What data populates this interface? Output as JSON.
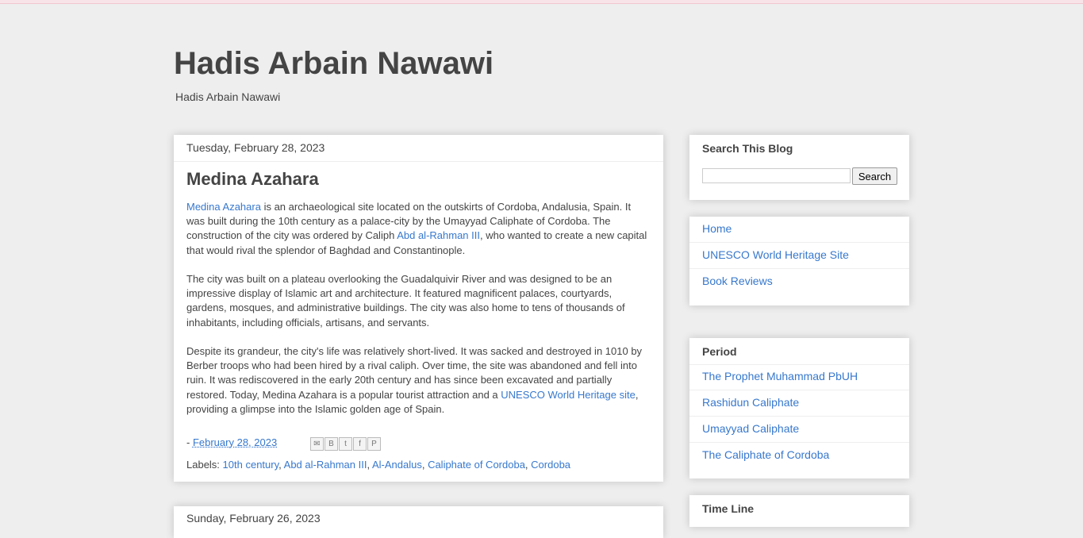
{
  "header": {
    "title": "Hadis Arbain Nawawi",
    "description": "Hadis Arbain Nawawi"
  },
  "post": {
    "date_header": "Tuesday, February 28, 2023",
    "title": "Medina Azahara",
    "p1_link1": "Medina Azahara",
    "p1_text1": " is an archaeological site located on the outskirts of Cordoba, Andalusia, Spain. It was built during the 10th century as a palace-city by the Umayyad Caliphate of Cordoba. The construction of the city was ordered by Caliph ",
    "p1_link2": "Abd al-Rahman III",
    "p1_text2": ", who wanted to create a new capital that would rival the splendor of Baghdad and Constantinople.",
    "p2_text": "The city was built on a plateau overlooking the Guadalquivir River and was designed to be an impressive display of Islamic art and architecture. It featured magnificent palaces, courtyards, gardens, mosques, and administrative buildings. The city was also home to tens of thousands of inhabitants, including officials, artisans, and servants.",
    "p3_text1": "Despite its grandeur, the city's life was relatively short-lived. It was sacked and destroyed in 1010 by Berber troops who had been hired by a rival caliph. Over time, the site was abandoned and fell into ruin. It was rediscovered in the early 20th century and has since been excavated and partially restored. Today, Medina Azahara is a popular tourist attraction and a ",
    "p3_link": "UNESCO World Heritage site",
    "p3_text2": ", providing a glimpse into the Islamic golden age of Spain.",
    "footer_prefix": "- ",
    "timestamp": "February 28, 2023",
    "share_icons": [
      "email-icon",
      "blogger-icon",
      "twitter-icon",
      "facebook-icon",
      "pinterest-icon"
    ],
    "labels_prefix": "Labels: ",
    "labels": [
      "10th century",
      "Abd al-Rahman III",
      "Al-Andalus",
      "Caliphate of Cordoba",
      "Cordoba"
    ],
    "label_sep": ", "
  },
  "next_post": {
    "date_header": "Sunday, February 26, 2023"
  },
  "sidebar": {
    "search": {
      "title": "Search This Blog",
      "button_label": "Search",
      "placeholder": ""
    },
    "pages": [
      "Home",
      "UNESCO World Heritage Site",
      "Book Reviews"
    ],
    "period": {
      "title": "Period",
      "items": [
        "The Prophet Muhammad PbUH",
        "Rashidun Caliphate",
        "Umayyad Caliphate",
        "The Caliphate of Cordoba"
      ]
    },
    "timeline": {
      "title": "Time Line"
    }
  },
  "colors": {
    "link": "#3778cd",
    "background": "#eeeeee",
    "text": "#444444"
  }
}
